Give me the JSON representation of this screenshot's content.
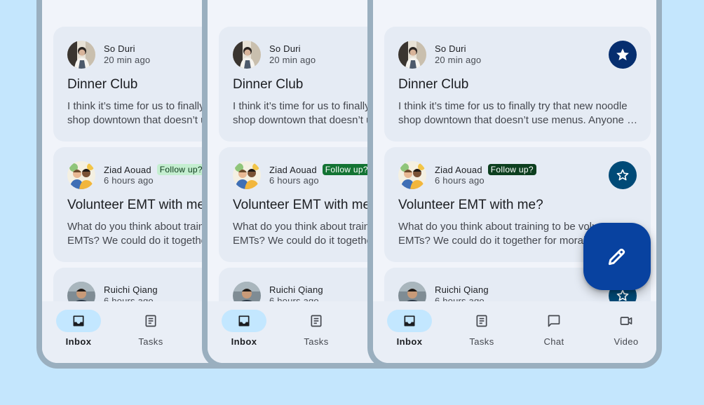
{
  "variants": [
    {
      "star_filled_bg": "#0b57d0",
      "star_outline_bg": "#c3e7ff",
      "star_outline_color": "#0b1d33",
      "tag_bg": "#c4eed0",
      "tag_color": "#0a3818",
      "fab_bg": "#d3e3fd",
      "fab_icon_color": "#041e49",
      "nav_pill_bg": "#c3e7ff"
    },
    {
      "star_filled_bg": "#0842a0",
      "star_outline_bg": "#0f7ec2",
      "star_outline_color": "#ffffff",
      "tag_bg": "#137333",
      "tag_color": "#ffffff",
      "fab_bg": "#1b6ef3",
      "fab_icon_color": "#ffffff",
      "nav_pill_bg": "#c3e7ff"
    },
    {
      "star_filled_bg": "#062e6f",
      "star_outline_bg": "#004a77",
      "star_outline_color": "#ffffff",
      "tag_bg": "#0d3f1f",
      "tag_color": "#ffffff",
      "fab_bg": "#0842a0",
      "fab_icon_color": "#ffffff",
      "nav_pill_bg": "#c3e7ff"
    }
  ],
  "emails": {
    "dinner": {
      "sender": "So Duri",
      "time": "20 min ago",
      "subject": "Dinner Club",
      "preview_line1": "I think it’s time for us to finally try that new noodle",
      "preview_line2": "shop downtown that doesn’t use menus. Anyone els…",
      "starred": true
    },
    "ziad": {
      "sender": "Ziad Aouad",
      "tag": "Follow up?",
      "time": "6 hours ago",
      "subject": "Volunteer EMT with me?",
      "preview_line1": "What do you think about training to be volunteer",
      "preview_line2": "EMTs? We could do it together for moral support.",
      "starred": false
    },
    "ruichi": {
      "sender": "Ruichi Qiang",
      "time": "6 hours ago",
      "starred": false
    }
  },
  "nav": {
    "items": [
      {
        "label": "Inbox",
        "icon": "inbox-icon",
        "active": true
      },
      {
        "label": "Tasks",
        "icon": "tasks-icon",
        "active": false
      },
      {
        "label": "Chat",
        "icon": "chat-icon",
        "active": false
      },
      {
        "label": "Video",
        "icon": "video-icon",
        "active": false
      }
    ]
  },
  "fab": {
    "icon": "edit-pencil-icon"
  }
}
